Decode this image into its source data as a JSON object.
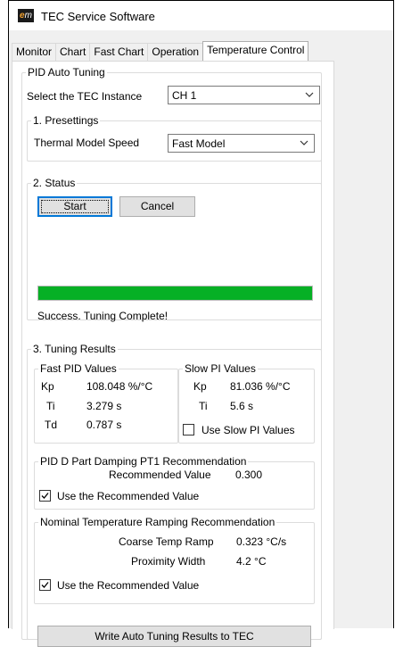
{
  "window": {
    "title": "TEC Service Software",
    "icon": "em-logo"
  },
  "tabs": [
    "Monitor",
    "Chart",
    "Fast Chart",
    "Operation",
    "Temperature Control"
  ],
  "active_tab": "Temperature Control",
  "pid_auto_tuning": {
    "legend": "PID Auto Tuning",
    "instance_label": "Select the TEC Instance",
    "instance_value": "CH 1",
    "presettings": {
      "legend": "1. Presettings",
      "model_label": "Thermal Model Speed",
      "model_value": "Fast Model"
    },
    "status": {
      "legend": "2. Status",
      "start_label": "Start",
      "cancel_label": "Cancel",
      "progress": 1.0,
      "message": "Success. Tuning Complete!"
    },
    "results": {
      "legend": "3. Tuning Results",
      "fast_pid": {
        "legend": "Fast PID Values",
        "kp_label": "Kp",
        "kp_value": "108.048 %/°C",
        "ti_label": "Ti",
        "ti_value": "3.279 s",
        "td_label": "Td",
        "td_value": "0.787 s"
      },
      "slow_pi": {
        "legend": "Slow PI Values",
        "kp_label": "Kp",
        "kp_value": "81.036 %/°C",
        "ti_label": "Ti",
        "ti_value": "5.6 s",
        "use_label": "Use Slow PI Values",
        "use_checked": false
      },
      "damping": {
        "legend": "PID D Part Damping PT1 Recommendation",
        "rec_label": "Recommended Value",
        "rec_value": "0.300",
        "use_label": "Use the Recommended Value",
        "use_checked": true
      },
      "ramping": {
        "legend": "Nominal Temperature Ramping Recommendation",
        "coarse_label": "Coarse Temp Ramp",
        "coarse_value": "0.323 °C/s",
        "proximity_label": "Proximity Width",
        "proximity_value": "4.2 °C",
        "use_label": "Use the Recommended Value",
        "use_checked": true
      },
      "write_label": "Write Auto Tuning Results to TEC"
    }
  }
}
